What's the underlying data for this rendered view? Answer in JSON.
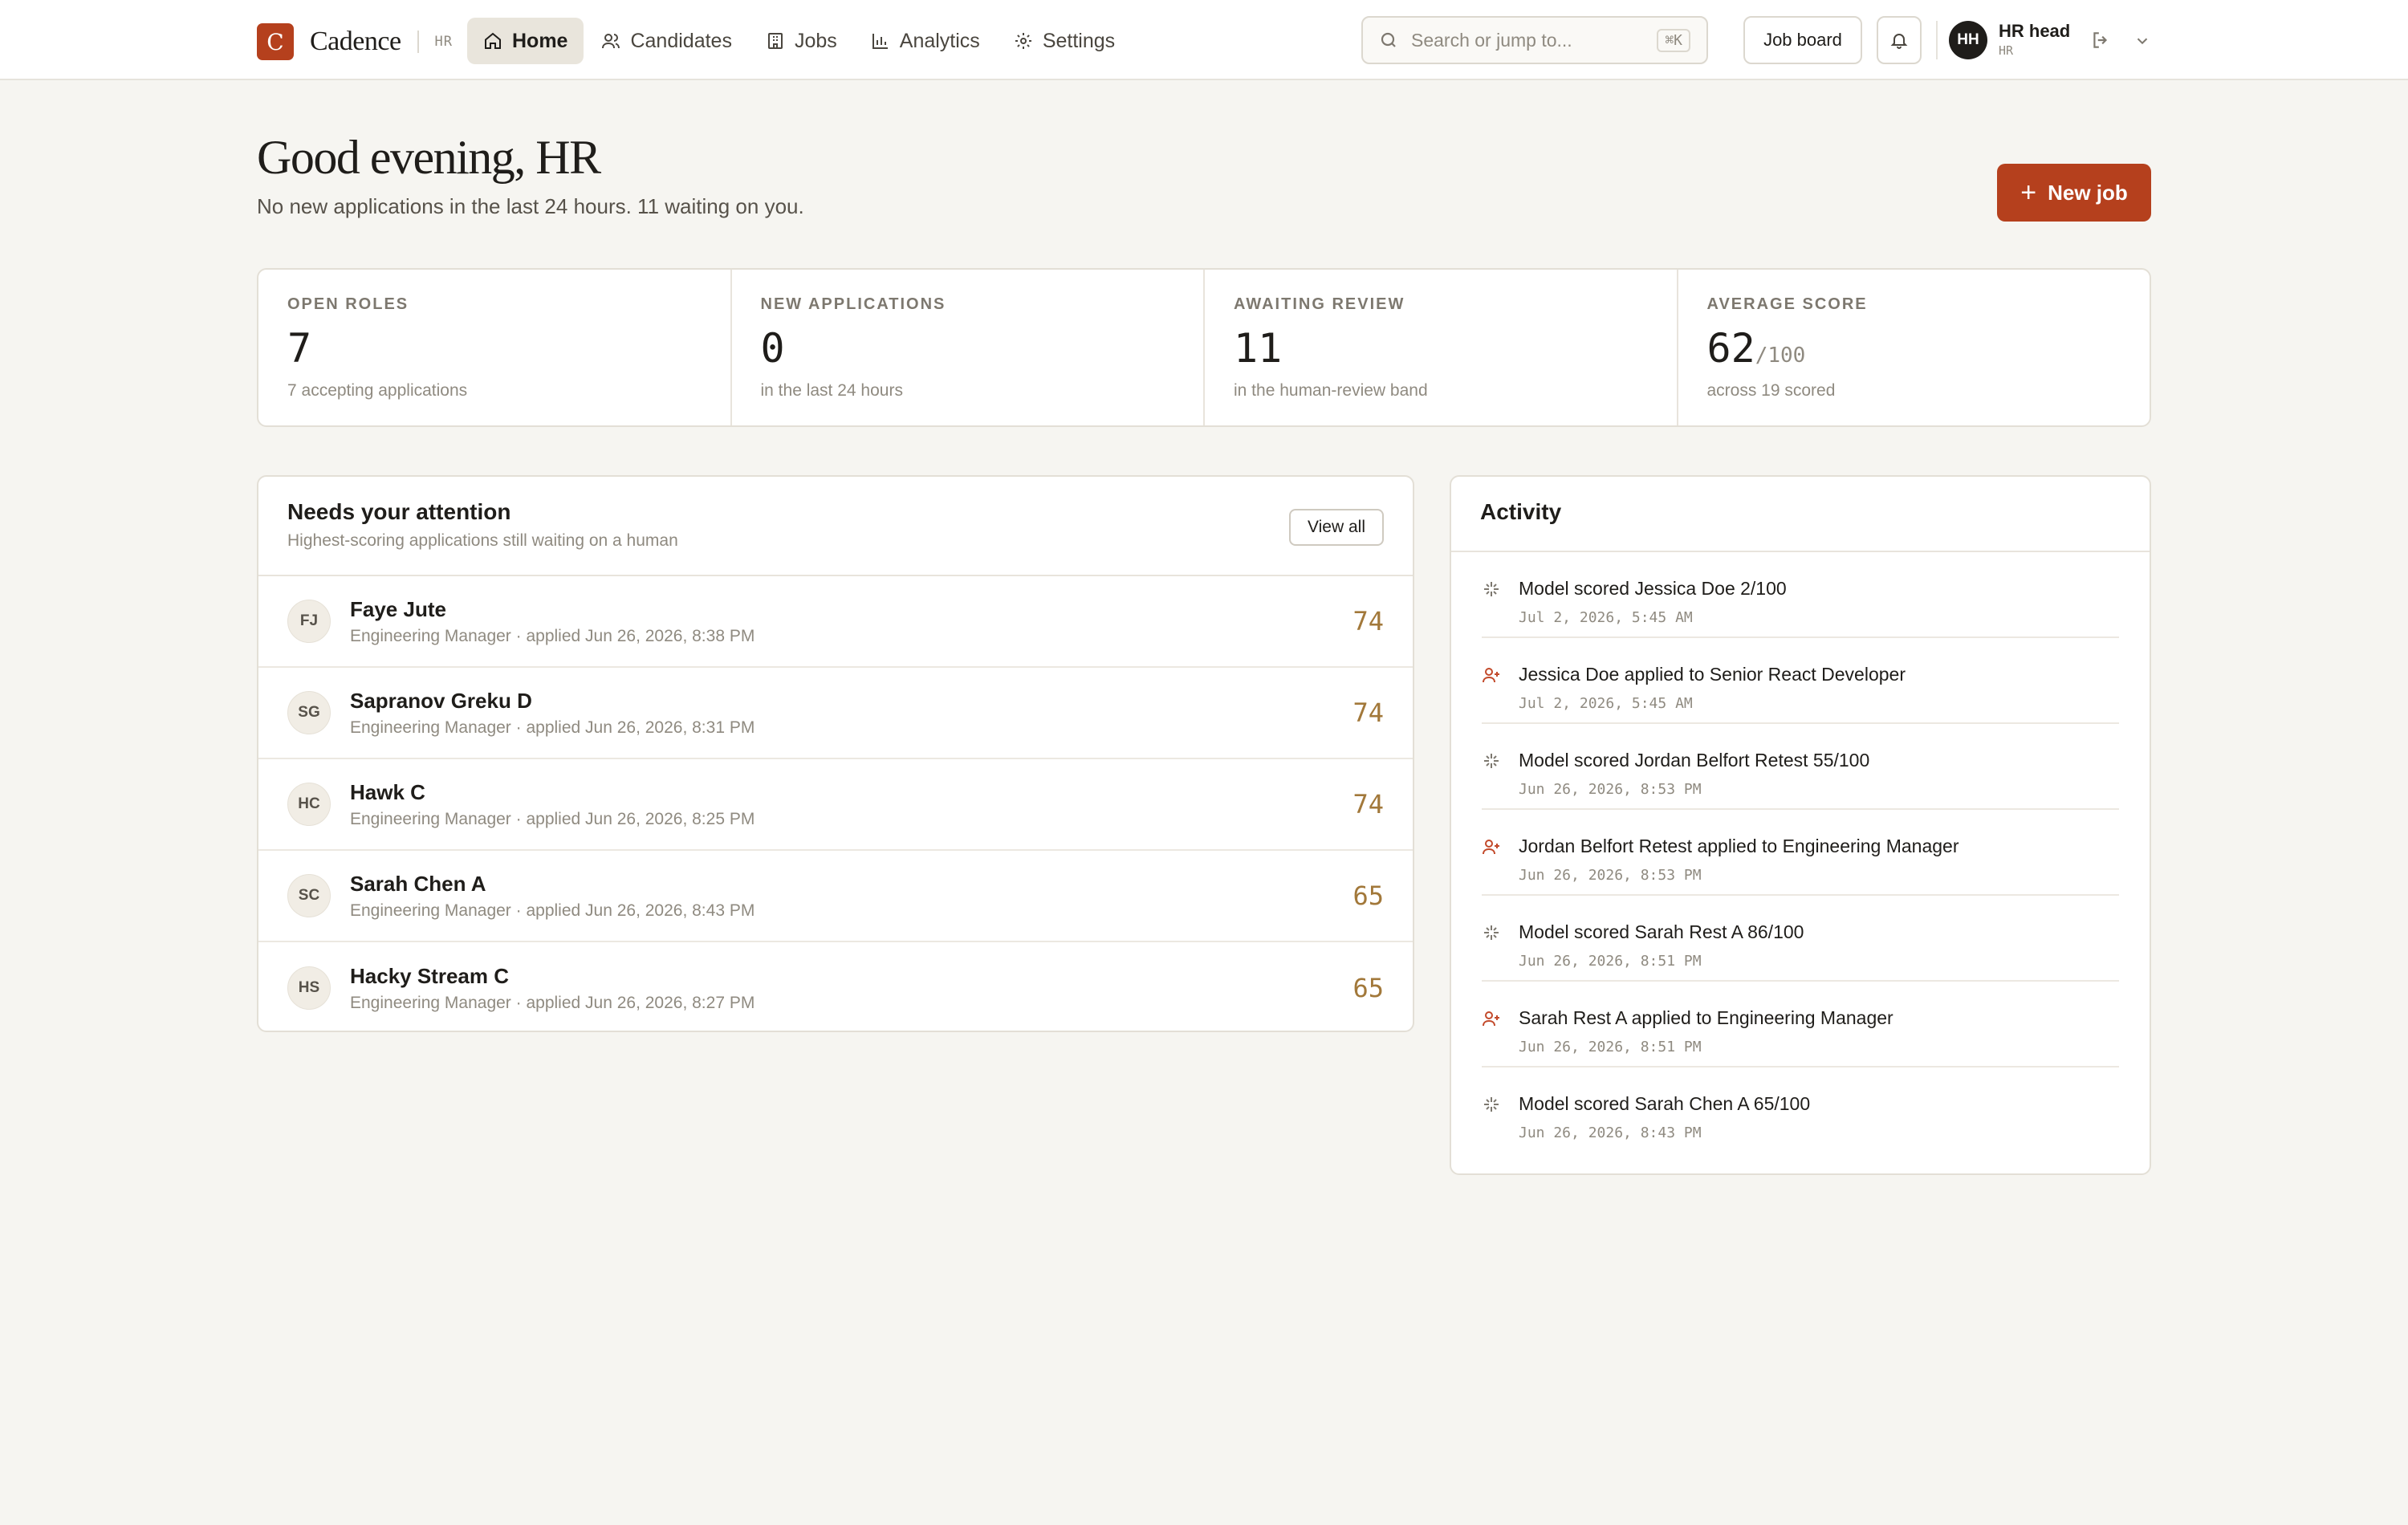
{
  "brand": {
    "mark": "C",
    "name": "Cadence",
    "tag": "HR"
  },
  "nav": [
    {
      "label": "Home",
      "icon": "home-icon",
      "active": true
    },
    {
      "label": "Candidates",
      "icon": "users-icon"
    },
    {
      "label": "Jobs",
      "icon": "building-icon"
    },
    {
      "label": "Analytics",
      "icon": "bar-chart-icon"
    },
    {
      "label": "Settings",
      "icon": "gear-icon"
    }
  ],
  "search": {
    "placeholder": "Search or jump to...",
    "shortcut": "⌘K"
  },
  "header_actions": {
    "job_board_label": "Job board"
  },
  "user": {
    "initials": "HH",
    "name": "HR head",
    "role": "HR"
  },
  "page": {
    "greeting": "Good evening, HR",
    "subline": "No new applications in the last 24 hours. 11 waiting on you.",
    "new_job_label": "New job"
  },
  "stats": [
    {
      "label": "OPEN ROLES",
      "value": "7",
      "suffix": "",
      "note": "7 accepting applications"
    },
    {
      "label": "NEW APPLICATIONS",
      "value": "0",
      "suffix": "",
      "note": "in the last 24 hours"
    },
    {
      "label": "AWAITING REVIEW",
      "value": "11",
      "suffix": "",
      "note": "in the human-review band"
    },
    {
      "label": "AVERAGE SCORE",
      "value": "62",
      "suffix": "/100",
      "note": "across 19 scored"
    }
  ],
  "attention": {
    "title": "Needs your attention",
    "subtitle": "Highest-scoring applications still waiting on a human",
    "view_all_label": "View all",
    "rows": [
      {
        "initials": "FJ",
        "name": "Faye Jute",
        "meta": "Engineering Manager · applied Jun 26, 2026, 8:38 PM",
        "score": "74"
      },
      {
        "initials": "SG",
        "name": "Sapranov Greku D",
        "meta": "Engineering Manager · applied Jun 26, 2026, 8:31 PM",
        "score": "74"
      },
      {
        "initials": "HC",
        "name": "Hawk C",
        "meta": "Engineering Manager · applied Jun 26, 2026, 8:25 PM",
        "score": "74"
      },
      {
        "initials": "SC",
        "name": "Sarah Chen A",
        "meta": "Engineering Manager · applied Jun 26, 2026, 8:43 PM",
        "score": "65"
      },
      {
        "initials": "HS",
        "name": "Hacky Stream C",
        "meta": "Engineering Manager · applied Jun 26, 2026, 8:27 PM",
        "score": "65"
      }
    ]
  },
  "activity": {
    "title": "Activity",
    "items": [
      {
        "kind": "score",
        "icon": "sparkle-icon",
        "text": "Model scored Jessica Doe 2/100",
        "time": "Jul 2, 2026, 5:45 AM"
      },
      {
        "kind": "apply",
        "icon": "user-plus-icon",
        "text": "Jessica Doe applied to Senior React Developer",
        "time": "Jul 2, 2026, 5:45 AM"
      },
      {
        "kind": "score",
        "icon": "sparkle-icon",
        "text": "Model scored Jordan Belfort Retest 55/100",
        "time": "Jun 26, 2026, 8:53 PM"
      },
      {
        "kind": "apply",
        "icon": "user-plus-icon",
        "text": "Jordan Belfort Retest applied to Engineering Manager",
        "time": "Jun 26, 2026, 8:53 PM"
      },
      {
        "kind": "score",
        "icon": "sparkle-icon",
        "text": "Model scored Sarah Rest A 86/100",
        "time": "Jun 26, 2026, 8:51 PM"
      },
      {
        "kind": "apply",
        "icon": "user-plus-icon",
        "text": "Sarah Rest A applied to Engineering Manager",
        "time": "Jun 26, 2026, 8:51 PM"
      },
      {
        "kind": "score",
        "icon": "sparkle-icon",
        "text": "Model scored Sarah Chen A 65/100",
        "time": "Jun 26, 2026, 8:43 PM"
      }
    ]
  },
  "colors": {
    "accent": "#b5401d",
    "score": "#a2783a",
    "background": "#f6f5f1"
  }
}
